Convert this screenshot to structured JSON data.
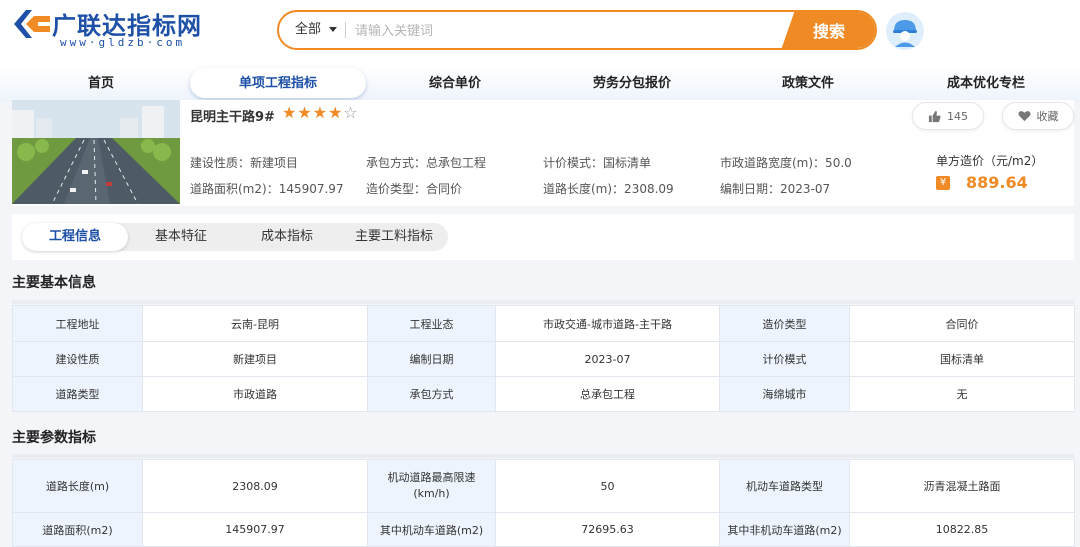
{
  "header": {
    "logo_name": "广联达指标网",
    "logo_url": "www·gldzb·com",
    "search": {
      "category": "全部",
      "placeholder": "请输入关键词",
      "button_label": "搜索"
    }
  },
  "nav": {
    "items": [
      {
        "label": "首页"
      },
      {
        "label": "单项工程指标",
        "active": true
      },
      {
        "label": "综合单价"
      },
      {
        "label": "劳务分包报价"
      },
      {
        "label": "政策文件"
      },
      {
        "label": "成本优化专栏"
      }
    ]
  },
  "project": {
    "name": "昆明主干路9#",
    "rating": 4,
    "rating_max": 5,
    "like_count": "145",
    "favorite_label": "收藏",
    "meta": {
      "build_nature": "建设性质：新建项目",
      "contract_mode": "承包方式：总承包工程",
      "pricing_mode": "计价模式：国标清单",
      "road_width": "市政道路宽度(m)：50.0",
      "road_area": "道路面积(m2)：145907.97",
      "cost_type": "造价类型：合同价",
      "road_length": "道路长度(m)：2308.09",
      "compile_date": "编制日期：2023-07"
    },
    "unit_price_label": "单方造价（元/m2）",
    "unit_price_value": "889.64",
    "price_icon": "¥"
  },
  "tabs": [
    {
      "label": "工程信息",
      "active": true
    },
    {
      "label": "基本特征"
    },
    {
      "label": "成本指标"
    },
    {
      "label": "主要工料指标"
    }
  ],
  "basic_info": {
    "title": "主要基本信息",
    "rows": [
      [
        "工程地址",
        "云南-昆明",
        "工程业态",
        "市政交通-城市道路-主干路",
        "造价类型",
        "合同价"
      ],
      [
        "建设性质",
        "新建项目",
        "编制日期",
        "2023-07",
        "计价模式",
        "国标清单"
      ],
      [
        "道路类型",
        "市政道路",
        "承包方式",
        "总承包工程",
        "海绵城市",
        "无"
      ]
    ]
  },
  "params": {
    "title": "主要参数指标",
    "rows": [
      [
        "道路长度(m)",
        "2308.09",
        "机动道路最高限速(km/h)",
        "50",
        "机动车道路类型",
        "沥青混凝土路面"
      ],
      [
        "道路面积(m2)",
        "145907.97",
        "其中机动车道路(m2)",
        "72695.63",
        "其中非机动车道路(m2)",
        "10822.85"
      ]
    ]
  },
  "colors": {
    "brand_blue": "#1e50a8",
    "accent_orange": "#f08a24",
    "table_key_bg": "#eef4fd"
  }
}
